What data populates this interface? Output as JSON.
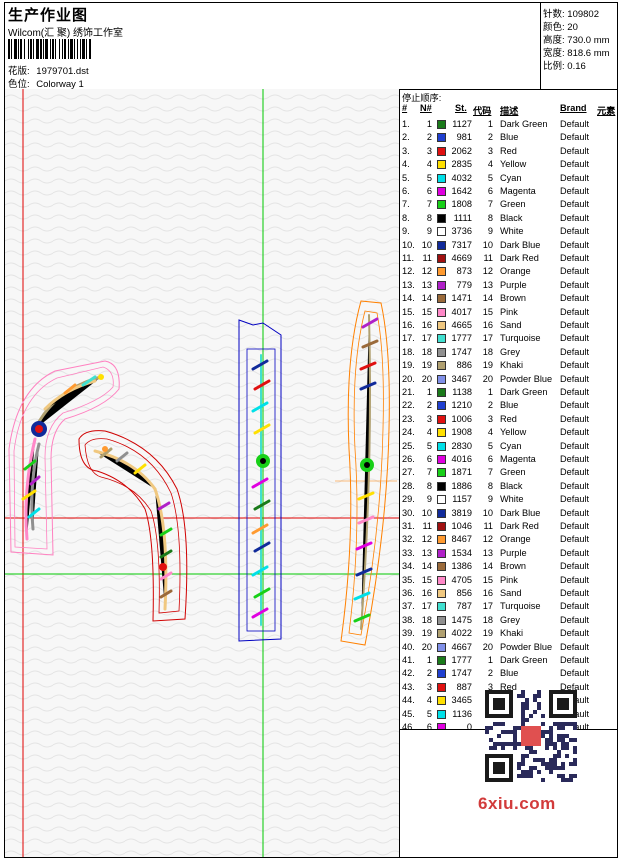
{
  "header": {
    "title": "生产作业图",
    "subtitle": "Wilcom(汇 聚) 绣饰工作室",
    "design_label": "花版:",
    "design_value": "1979701.dst",
    "colorway_label": "色位:",
    "colorway_value": "Colorway 1"
  },
  "specs": {
    "stitches_label": "针数:",
    "stitches_value": "109802",
    "colors_label": "颜色:",
    "colors_value": "20",
    "height_label": "高度:",
    "height_value": "730.0 mm",
    "width_label": "宽度:",
    "width_value": "818.6 mm",
    "scale_label": "比例:",
    "scale_value": "0.16"
  },
  "table": {
    "stop_sequence_label": "停止顺序:",
    "headers": {
      "idx": "#",
      "n": "N#",
      "st": "St.",
      "code": "代码",
      "desc": "描述",
      "brand": "Brand",
      "elem": "元素"
    },
    "rows": [
      {
        "idx": "1.",
        "n": "1",
        "color": "#1a7a1a",
        "st": "1127",
        "code": "1",
        "desc": "Dark Green",
        "brand": "Default"
      },
      {
        "idx": "2.",
        "n": "2",
        "color": "#1f3fd0",
        "st": "981",
        "code": "2",
        "desc": "Blue",
        "brand": "Default"
      },
      {
        "idx": "3.",
        "n": "3",
        "color": "#e01010",
        "st": "2062",
        "code": "3",
        "desc": "Red",
        "brand": "Default"
      },
      {
        "idx": "4.",
        "n": "4",
        "color": "#ffe000",
        "st": "2835",
        "code": "4",
        "desc": "Yellow",
        "brand": "Default"
      },
      {
        "idx": "5.",
        "n": "5",
        "color": "#00e0e8",
        "st": "4032",
        "code": "5",
        "desc": "Cyan",
        "brand": "Default"
      },
      {
        "idx": "6.",
        "n": "6",
        "color": "#e000e0",
        "st": "1642",
        "code": "6",
        "desc": "Magenta",
        "brand": "Default"
      },
      {
        "idx": "7.",
        "n": "7",
        "color": "#18d018",
        "st": "1808",
        "code": "7",
        "desc": "Green",
        "brand": "Default"
      },
      {
        "idx": "8.",
        "n": "8",
        "color": "#000000",
        "st": "1111",
        "code": "8",
        "desc": "Black",
        "brand": "Default"
      },
      {
        "idx": "9.",
        "n": "9",
        "color": "#ffffff",
        "st": "3736",
        "code": "9",
        "desc": "White",
        "brand": "Default"
      },
      {
        "idx": "10.",
        "n": "10",
        "color": "#102a9a",
        "st": "7317",
        "code": "10",
        "desc": "Dark Blue",
        "brand": "Default"
      },
      {
        "idx": "11.",
        "n": "11",
        "color": "#a01010",
        "st": "4669",
        "code": "11",
        "desc": "Dark Red",
        "brand": "Default"
      },
      {
        "idx": "12.",
        "n": "12",
        "color": "#ff9a30",
        "st": "873",
        "code": "12",
        "desc": "Orange",
        "brand": "Default"
      },
      {
        "idx": "13.",
        "n": "13",
        "color": "#b020c8",
        "st": "779",
        "code": "13",
        "desc": "Purple",
        "brand": "Default"
      },
      {
        "idx": "14.",
        "n": "14",
        "color": "#9a6a3a",
        "st": "1471",
        "code": "14",
        "desc": "Brown",
        "brand": "Default"
      },
      {
        "idx": "15.",
        "n": "15",
        "color": "#ff88c8",
        "st": "4017",
        "code": "15",
        "desc": "Pink",
        "brand": "Default"
      },
      {
        "idx": "16.",
        "n": "16",
        "color": "#f0c880",
        "st": "4665",
        "code": "16",
        "desc": "Sand",
        "brand": "Default"
      },
      {
        "idx": "17.",
        "n": "17",
        "color": "#40e0d0",
        "st": "1777",
        "code": "17",
        "desc": "Turquoise",
        "brand": "Default"
      },
      {
        "idx": "18.",
        "n": "18",
        "color": "#909090",
        "st": "1747",
        "code": "18",
        "desc": "Grey",
        "brand": "Default"
      },
      {
        "idx": "19.",
        "n": "19",
        "color": "#b0a070",
        "st": "886",
        "code": "19",
        "desc": "Khaki",
        "brand": "Default"
      },
      {
        "idx": "20.",
        "n": "20",
        "color": "#8090e8",
        "st": "3467",
        "code": "20",
        "desc": "Powder Blue",
        "brand": "Default"
      },
      {
        "idx": "21.",
        "n": "1",
        "color": "#1a7a1a",
        "st": "1138",
        "code": "1",
        "desc": "Dark Green",
        "brand": "Default"
      },
      {
        "idx": "22.",
        "n": "2",
        "color": "#1f3fd0",
        "st": "1210",
        "code": "2",
        "desc": "Blue",
        "brand": "Default"
      },
      {
        "idx": "23.",
        "n": "3",
        "color": "#e01010",
        "st": "1006",
        "code": "3",
        "desc": "Red",
        "brand": "Default"
      },
      {
        "idx": "24.",
        "n": "4",
        "color": "#ffe000",
        "st": "1908",
        "code": "4",
        "desc": "Yellow",
        "brand": "Default"
      },
      {
        "idx": "25.",
        "n": "5",
        "color": "#00e0e8",
        "st": "2830",
        "code": "5",
        "desc": "Cyan",
        "brand": "Default"
      },
      {
        "idx": "26.",
        "n": "6",
        "color": "#e000e0",
        "st": "4016",
        "code": "6",
        "desc": "Magenta",
        "brand": "Default"
      },
      {
        "idx": "27.",
        "n": "7",
        "color": "#18d018",
        "st": "1871",
        "code": "7",
        "desc": "Green",
        "brand": "Default"
      },
      {
        "idx": "28.",
        "n": "8",
        "color": "#000000",
        "st": "1886",
        "code": "8",
        "desc": "Black",
        "brand": "Default"
      },
      {
        "idx": "29.",
        "n": "9",
        "color": "#ffffff",
        "st": "1157",
        "code": "9",
        "desc": "White",
        "brand": "Default"
      },
      {
        "idx": "30.",
        "n": "10",
        "color": "#102a9a",
        "st": "3819",
        "code": "10",
        "desc": "Dark Blue",
        "brand": "Default"
      },
      {
        "idx": "31.",
        "n": "11",
        "color": "#a01010",
        "st": "1046",
        "code": "11",
        "desc": "Dark Red",
        "brand": "Default"
      },
      {
        "idx": "32.",
        "n": "12",
        "color": "#ff9a30",
        "st": "8467",
        "code": "12",
        "desc": "Orange",
        "brand": "Default"
      },
      {
        "idx": "33.",
        "n": "13",
        "color": "#b020c8",
        "st": "1534",
        "code": "13",
        "desc": "Purple",
        "brand": "Default"
      },
      {
        "idx": "34.",
        "n": "14",
        "color": "#9a6a3a",
        "st": "1386",
        "code": "14",
        "desc": "Brown",
        "brand": "Default"
      },
      {
        "idx": "35.",
        "n": "15",
        "color": "#ff88c8",
        "st": "4705",
        "code": "15",
        "desc": "Pink",
        "brand": "Default"
      },
      {
        "idx": "36.",
        "n": "16",
        "color": "#f0c880",
        "st": "856",
        "code": "16",
        "desc": "Sand",
        "brand": "Default"
      },
      {
        "idx": "37.",
        "n": "17",
        "color": "#40e0d0",
        "st": "787",
        "code": "17",
        "desc": "Turquoise",
        "brand": "Default"
      },
      {
        "idx": "38.",
        "n": "18",
        "color": "#909090",
        "st": "1475",
        "code": "18",
        "desc": "Grey",
        "brand": "Default"
      },
      {
        "idx": "39.",
        "n": "19",
        "color": "#b0a070",
        "st": "4022",
        "code": "19",
        "desc": "Khaki",
        "brand": "Default"
      },
      {
        "idx": "40.",
        "n": "20",
        "color": "#8090e8",
        "st": "4667",
        "code": "20",
        "desc": "Powder Blue",
        "brand": "Default"
      },
      {
        "idx": "41.",
        "n": "1",
        "color": "#1a7a1a",
        "st": "1777",
        "code": "1",
        "desc": "Dark Green",
        "brand": "Default"
      },
      {
        "idx": "42.",
        "n": "2",
        "color": "#1f3fd0",
        "st": "1747",
        "code": "2",
        "desc": "Blue",
        "brand": "Default"
      },
      {
        "idx": "43.",
        "n": "3",
        "color": "#e01010",
        "st": "887",
        "code": "3",
        "desc": "Red",
        "brand": "Default"
      },
      {
        "idx": "44.",
        "n": "4",
        "color": "#ffe000",
        "st": "3465",
        "code": "",
        "desc": "",
        "brand": "Default"
      },
      {
        "idx": "45.",
        "n": "5",
        "color": "#00e0e8",
        "st": "1136",
        "code": "",
        "desc": "",
        "brand": "Default"
      },
      {
        "idx": "46.",
        "n": "6",
        "color": "#e000e0",
        "st": "0",
        "code": "",
        "desc": "",
        "brand": "Default"
      }
    ]
  },
  "watermark": "6xiu.com",
  "colors": {
    "guide_red": "#e00000",
    "guide_green": "#00c800",
    "outline_pink": "#ff80c0",
    "outline_red": "#d00000",
    "outline_blue": "#0000c0",
    "outline_orange": "#ff8000"
  }
}
